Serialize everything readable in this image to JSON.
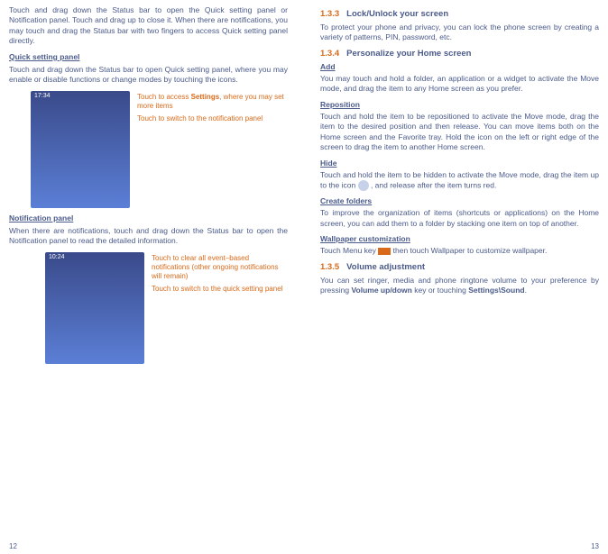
{
  "left": {
    "intro": "Touch and drag down the Status bar to open the Quick setting panel or Notification panel. Touch and drag up to close it. When there are notifications, you may touch and drag the Status bar with two fingers to access Quick setting panel directly.",
    "quick_title": "Quick setting panel",
    "quick_body": "Touch and drag down the Status bar to open Quick setting panel, where you may enable or disable functions or change modes by touching the icons.",
    "quick_callout1a": "Touch to access ",
    "quick_callout1b": "Settings",
    "quick_callout1c": ", where you may set more items",
    "quick_callout2": "Touch to switch to the notification panel",
    "phone_time1": "17:34",
    "notif_title": "Notification panel",
    "notif_body": "When there are notifications, touch and drag down the Status bar to open the Notification panel to read the detailed information.",
    "notif_callout1": "Touch to clear all event–based notifications (other ongoing notifications will remain)",
    "notif_callout2": "Touch to switch to the quick setting panel",
    "phone_time2": "10:24",
    "page_num": "12"
  },
  "right": {
    "h133_num": "1.3.3",
    "h133_txt": "Lock/Unlock your screen",
    "h133_body": "To protect your phone and privacy, you can lock the phone screen by creating a variety of patterns, PIN, password, etc.",
    "h134_num": "1.3.4",
    "h134_txt": "Personalize your Home screen",
    "add_title": "Add",
    "add_body": "You may touch and hold a folder, an application or a widget to activate the Move mode, and drag the item to any Home screen as you prefer.",
    "reposition_title": "Reposition",
    "reposition_body": "Touch and hold the item to be repositioned to activate the Move mode, drag the item to the desired position and then release. You can move items both on the Home screen and the Favorite tray. Hold the icon on the left or right edge of the screen to drag the item to another Home screen.",
    "hide_title": "Hide",
    "hide_body_a": "Touch and hold the item to be hidden to activate the Move mode, drag the item up to the icon ",
    "hide_body_b": " , and release after the item turns red.",
    "folders_title": "Create folders",
    "folders_body": "To improve the organization of items (shortcuts or applications) on the Home screen, you can add them to a folder by stacking one item on top of another.",
    "wallpaper_title": "Wallpaper customization",
    "wallpaper_body_a": "Touch Menu key ",
    "wallpaper_body_b": " then touch Wallpaper to customize wallpaper.",
    "h135_num": "1.3.5",
    "h135_txt": "Volume adjustment",
    "vol_body_a": "You can set ringer, media and phone ringtone volume to your preference by pressing ",
    "vol_body_b": "Volume up/down",
    "vol_body_c": " key or touching ",
    "vol_body_d": "Settings\\Sound",
    "vol_body_e": ".",
    "page_num": "13"
  }
}
